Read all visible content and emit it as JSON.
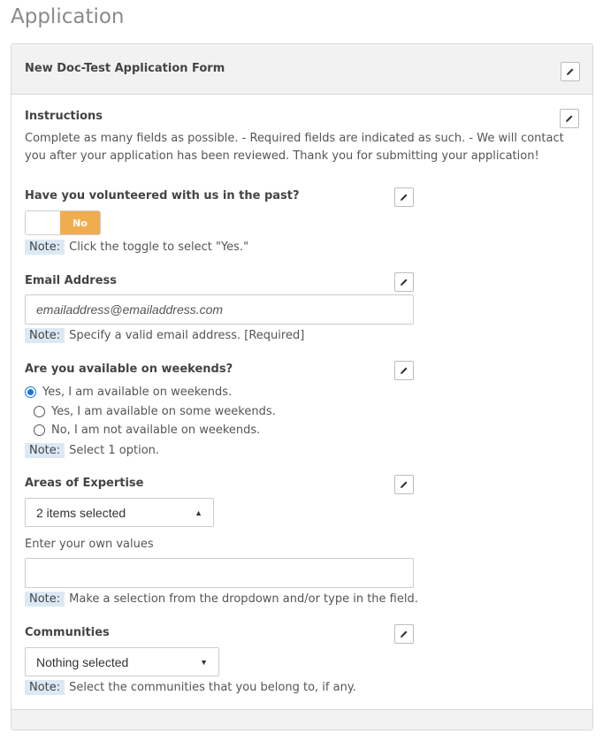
{
  "page": {
    "title": "Application"
  },
  "form": {
    "title": "New Doc-Test Application Form",
    "instructions": {
      "label": "Instructions",
      "body": "Complete as many fields as possible. - Required fields are indicated as such. - We will contact you after your application has been reviewed. Thank you for submitting your application!"
    },
    "volunteered": {
      "label": "Have you volunteered with us in the past?",
      "toggle_value": "No",
      "note_tag": "Note:",
      "note": "Click the toggle to select \"Yes.\""
    },
    "email": {
      "label": "Email Address",
      "placeholder": "emailaddress@emailaddress.com",
      "note_tag": "Note:",
      "note": "Specify a valid email address. [Required]"
    },
    "weekends": {
      "label": "Are you available on weekends?",
      "options": [
        {
          "label": "Yes, I am available on weekends.",
          "checked": true
        },
        {
          "label": "Yes, I am available on some weekends.",
          "checked": false
        },
        {
          "label": "No, I am not available on weekends.",
          "checked": false
        }
      ],
      "note_tag": "Note:",
      "note": "Select 1 option."
    },
    "expertise": {
      "label": "Areas of Expertise",
      "select_value": "2 items selected",
      "own_values_label": "Enter your own values",
      "own_values_value": "",
      "note_tag": "Note:",
      "note": "Make a selection from the dropdown and/or type in the field."
    },
    "communities": {
      "label": "Communities",
      "select_value": "Nothing selected",
      "note_tag": "Note:",
      "note": "Select the communities that you belong to, if any."
    }
  },
  "icons": {
    "edit": "pencil-icon",
    "caret_up": "caret-up-icon",
    "caret_down": "caret-down-icon"
  },
  "colors": {
    "toggle_on": "#f0ad4e",
    "note_bg": "#dce9f5",
    "radio_checked": "#1a73e8"
  }
}
